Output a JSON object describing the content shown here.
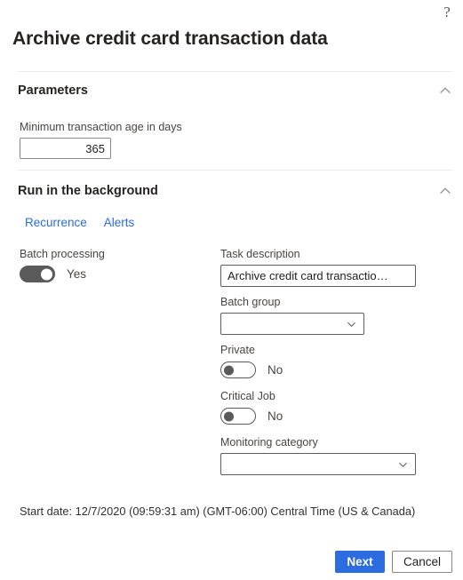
{
  "window": {
    "help_icon": "question-mark-help-icon",
    "title": "Archive credit card transaction data"
  },
  "sections": {
    "parameters": {
      "title": "Parameters",
      "collapse_icon": "chevron-up-icon",
      "min_age": {
        "label": "Minimum transaction age in days",
        "value": "365"
      }
    },
    "background": {
      "title": "Run in the background",
      "collapse_icon": "chevron-up-icon",
      "tabs": [
        {
          "label": "Recurrence"
        },
        {
          "label": "Alerts"
        }
      ],
      "batch_processing": {
        "label": "Batch processing",
        "state": "Yes"
      },
      "task_description": {
        "label": "Task description",
        "value": "Archive credit card transactio…"
      },
      "batch_group": {
        "label": "Batch group",
        "value": "",
        "chevron_icon": "chevron-down-icon"
      },
      "private": {
        "label": "Private",
        "state": "No"
      },
      "critical_job": {
        "label": "Critical Job",
        "state": "No"
      },
      "monitoring_category": {
        "label": "Monitoring category",
        "value": "",
        "chevron_icon": "chevron-down-icon"
      }
    }
  },
  "start_date": "Start date: 12/7/2020 (09:59:31 am) (GMT-06:00) Central Time (US & Canada)",
  "footer": {
    "next_label": "Next",
    "cancel_label": "Cancel"
  },
  "colors": {
    "accent_blue": "#2b6ce0",
    "link_blue": "#2b6ce0",
    "toggle_on": "#5a5a5a",
    "divider": "#edebe9",
    "text_primary": "#201f1e",
    "text_secondary": "#484644"
  }
}
